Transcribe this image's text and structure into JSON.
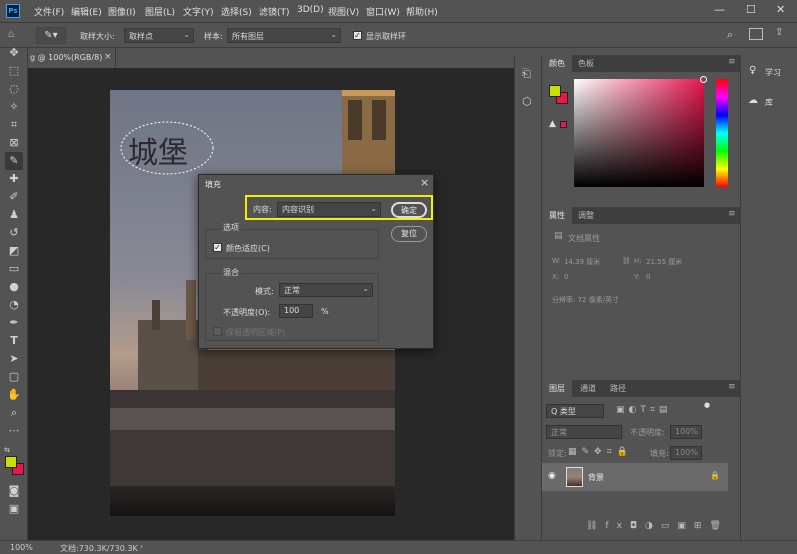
{
  "menubar": {
    "logo": "Ps",
    "items": [
      "文件(F)",
      "编辑(E)",
      "图像(I)",
      "图层(L)",
      "文字(Y)",
      "选择(S)",
      "滤镜(T)",
      "3D(D)",
      "视图(V)",
      "窗口(W)",
      "帮助(H)"
    ],
    "minimize": "—",
    "maximize": "☐",
    "close": "✕"
  },
  "options": {
    "sample_size_label": "取样大小:",
    "sample_size_value": "取样点",
    "sample_label": "样本:",
    "sample_value": "所有图层",
    "show_ring_label": "显示取样环"
  },
  "document": {
    "tab_title": "g @ 100%(RGB/8)",
    "overlay_text": "城堡"
  },
  "status": {
    "zoom": "100%",
    "doc_info": "文档:730.3K/730.3K"
  },
  "color_panel": {
    "tab_color": "颜色",
    "tab_swatches": "色板",
    "fg_color": "#c8e000",
    "bg_color": "#e8174f"
  },
  "properties_panel": {
    "tab_properties": "属性",
    "tab_adjustments": "调整",
    "doc_props": "文档属性",
    "w_label": "W:",
    "w_value": "14.39 厘米",
    "h_label": "H:",
    "h_value": "21.55 厘米",
    "x_label": "X:",
    "x_value": "0",
    "y_label": "Y:",
    "y_value": "0",
    "resolution": "分辨率: 72 像素/英寸"
  },
  "layers_panel": {
    "tab_layers": "图层",
    "tab_channels": "通道",
    "tab_paths": "路径",
    "kind": "Q 类型",
    "blend": "正常",
    "opacity_label": "不透明度:",
    "opacity_value": "100%",
    "lock_label": "锁定:",
    "fill_label": "填充:",
    "fill_value": "100%",
    "layer_name": "背景"
  },
  "far_right": {
    "learn": "学习",
    "libraries": "库"
  },
  "dialog": {
    "title": "填充",
    "content_label": "内容:",
    "content_value": "内容识别",
    "ok": "确定",
    "reset": "复位",
    "options_legend": "选项",
    "color_adapt": "颜色适应(C)",
    "blend_legend": "混合",
    "mode_label": "模式:",
    "mode_value": "正常",
    "opacity_label": "不透明度(O):",
    "opacity_value": "100",
    "percent": "%",
    "preserve": "保留透明区域(P)"
  }
}
